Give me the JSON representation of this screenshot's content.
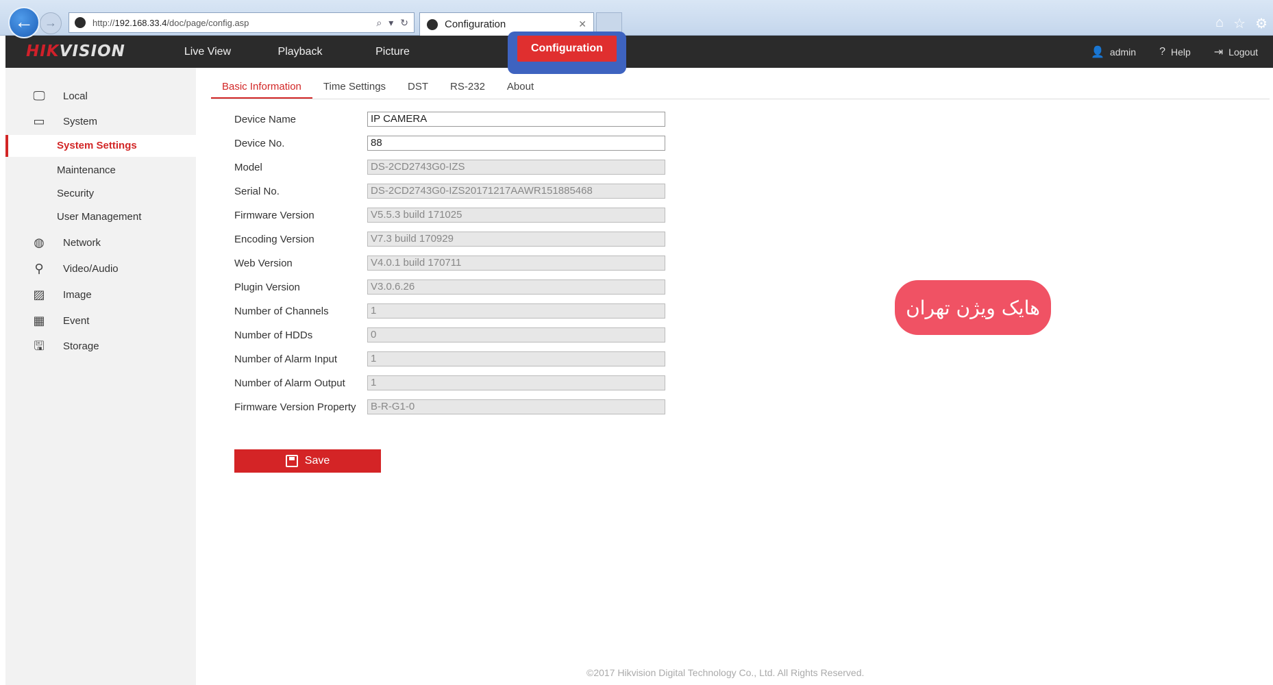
{
  "browser": {
    "url_prefix": "http://",
    "url_host": "192.168.33.4",
    "url_path": "/doc/page/config.asp",
    "tab_title": "Configuration",
    "tab_close": "✕"
  },
  "header": {
    "logo_red": "HIK",
    "logo_white": "VISION",
    "nav": [
      {
        "label": "Live View"
      },
      {
        "label": "Playback"
      },
      {
        "label": "Picture"
      },
      {
        "label": "Configuration"
      }
    ],
    "user": "admin",
    "help": "Help",
    "logout": "Logout"
  },
  "sidebar": {
    "items": [
      {
        "label": "Local",
        "icon": "monitor-icon"
      },
      {
        "label": "System",
        "icon": "system-icon"
      },
      {
        "label": "Network",
        "icon": "globe-icon"
      },
      {
        "label": "Video/Audio",
        "icon": "camera-mic-icon"
      },
      {
        "label": "Image",
        "icon": "image-icon"
      },
      {
        "label": "Event",
        "icon": "calendar-icon"
      },
      {
        "label": "Storage",
        "icon": "storage-icon"
      }
    ],
    "system_sub": [
      {
        "label": "System Settings"
      },
      {
        "label": "Maintenance"
      },
      {
        "label": "Security"
      },
      {
        "label": "User Management"
      }
    ]
  },
  "subtabs": [
    {
      "label": "Basic Information"
    },
    {
      "label": "Time Settings"
    },
    {
      "label": "DST"
    },
    {
      "label": "RS-232"
    },
    {
      "label": "About"
    }
  ],
  "form": {
    "rows": [
      {
        "label": "Device Name",
        "value": "IP CAMERA"
      },
      {
        "label": "Device No.",
        "value": "88"
      },
      {
        "label": "Model",
        "value": "DS-2CD2743G0-IZS"
      },
      {
        "label": "Serial No.",
        "value": "DS-2CD2743G0-IZS20171217AAWR151885468"
      },
      {
        "label": "Firmware Version",
        "value": "V5.5.3 build 171025"
      },
      {
        "label": "Encoding Version",
        "value": "V7.3 build 170929"
      },
      {
        "label": "Web Version",
        "value": "V4.0.1 build 170711"
      },
      {
        "label": "Plugin Version",
        "value": "V3.0.6.26"
      },
      {
        "label": "Number of Channels",
        "value": "1"
      },
      {
        "label": "Number of HDDs",
        "value": "0"
      },
      {
        "label": "Number of Alarm Input",
        "value": "1"
      },
      {
        "label": "Number of Alarm Output",
        "value": "1"
      },
      {
        "label": "Firmware Version Property",
        "value": "B-R-G1-0"
      }
    ],
    "save_label": "Save"
  },
  "badge_text": "هایک ویژن تهران",
  "footer": "©2017 Hikvision Digital Technology Co., Ltd. All Rights Reserved.",
  "colors": {
    "accent": "#d22626",
    "header_bg": "#2b2b2b",
    "badge": "#f05264",
    "highlight": "#3e63c0"
  }
}
